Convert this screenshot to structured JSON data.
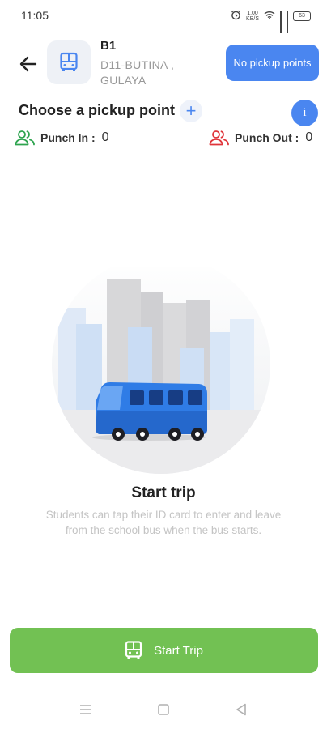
{
  "status_bar": {
    "time": "11:05",
    "net_speed_top": "1.00",
    "net_speed_bottom": "KB/S",
    "battery": "63"
  },
  "header": {
    "route_name": "B1",
    "route_sub": "D11-BUTINA , GULAYA",
    "no_pickup_label": "No pickup points"
  },
  "pickup": {
    "title": "Choose a pickup point",
    "add_symbol": "+",
    "info_symbol": "i"
  },
  "punch_in": {
    "label": "Punch In :",
    "value": "0"
  },
  "punch_out": {
    "label": "Punch Out :",
    "value": "0"
  },
  "empty_state": {
    "title": "Start trip",
    "description": "Students can tap their ID card to enter and leave from the school bus when the bus starts."
  },
  "start_button": {
    "label": "Start Trip"
  },
  "colors": {
    "accent_blue": "#4a86f0",
    "start_green": "#72c153",
    "punch_in_green": "#2ea44f",
    "punch_out_red": "#e0353b"
  },
  "icons": {
    "back": "arrow-left-icon",
    "bus": "bus-icon",
    "add": "plus-icon",
    "info": "info-icon",
    "punch_in": "users-icon",
    "punch_out": "users-icon"
  }
}
